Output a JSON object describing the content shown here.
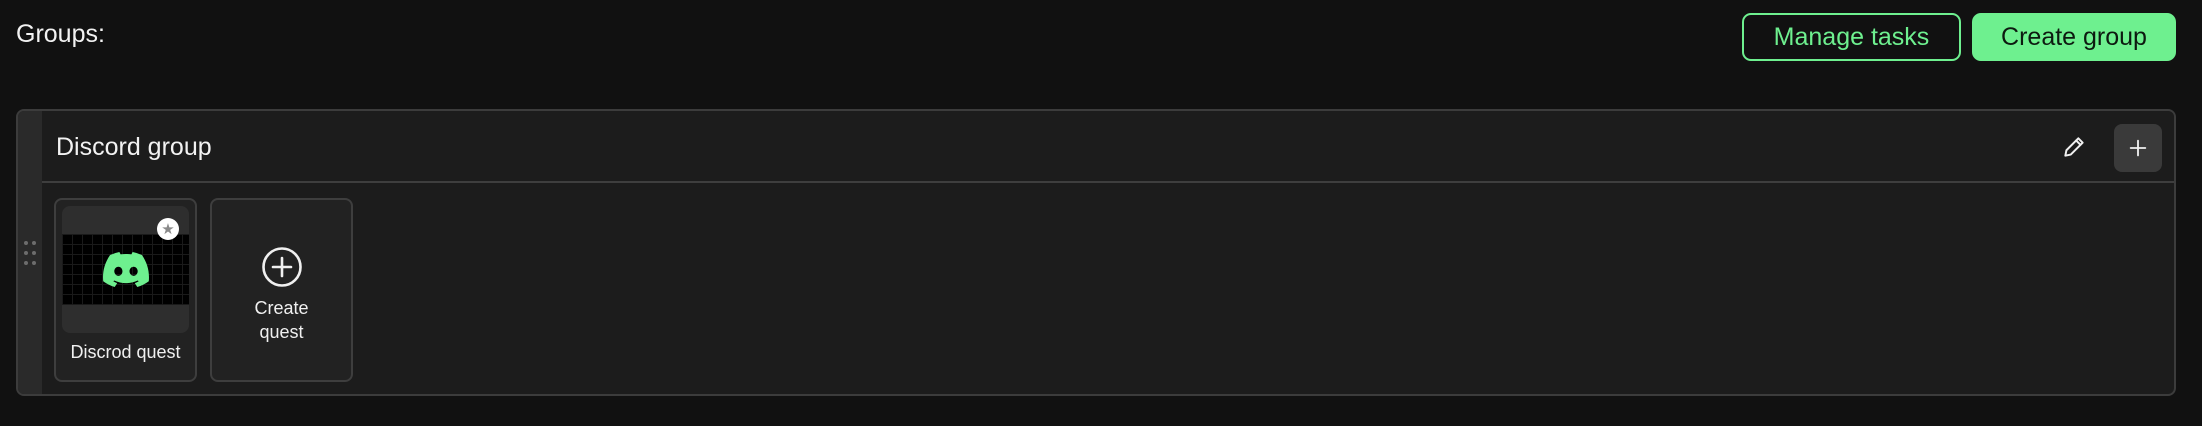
{
  "header": {
    "title": "Groups:",
    "manage_tasks_label": "Manage tasks",
    "create_group_label": "Create group"
  },
  "group": {
    "title": "Discord group",
    "edit_icon": "pencil-icon",
    "add_icon": "plus-icon",
    "quests": [
      {
        "name": "Discrod quest",
        "icon": "discord-icon",
        "favorite_icon": "star-icon"
      }
    ],
    "create_quest": {
      "label": "Create quest",
      "icon": "plus-circle-icon"
    }
  },
  "colors": {
    "accent": "#6ef08f",
    "background": "#111111",
    "card": "#1c1c1c"
  }
}
